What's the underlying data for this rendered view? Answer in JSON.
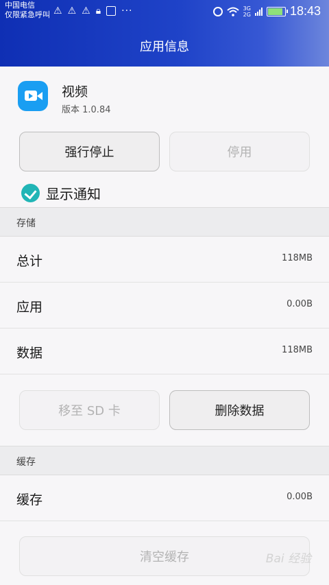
{
  "status_bar": {
    "carrier_line1": "中国电信",
    "carrier_line2": "仅限紧急呼叫",
    "net_top": "3G",
    "net_bottom": "2G",
    "time": "18:43",
    "icons": [
      "signal-warning-icon",
      "signal-warning-icon",
      "signal-warning-icon",
      "lock-icon",
      "image-icon",
      "more-dots-icon",
      "alarm-icon",
      "wifi-icon",
      "signal-bars-icon",
      "battery-charging-icon"
    ]
  },
  "header": {
    "title": "应用信息"
  },
  "app": {
    "name": "视频",
    "version": "版本 1.0.84",
    "icon": "video-camera-icon"
  },
  "actions": {
    "force_stop": "强行停止",
    "disable": "停用"
  },
  "notification": {
    "label": "显示通知",
    "checked": true
  },
  "storage": {
    "header": "存储",
    "rows": [
      {
        "label": "总计",
        "value": "118MB"
      },
      {
        "label": "应用",
        "value": "0.00B"
      },
      {
        "label": "数据",
        "value": "118MB"
      }
    ],
    "move_sd": "移至 SD 卡",
    "clear_data": "删除数据"
  },
  "cache": {
    "header": "缓存",
    "row": {
      "label": "缓存",
      "value": "0.00B"
    },
    "clear_cache": "清空缓存"
  },
  "watermark": "Bai 经验"
}
